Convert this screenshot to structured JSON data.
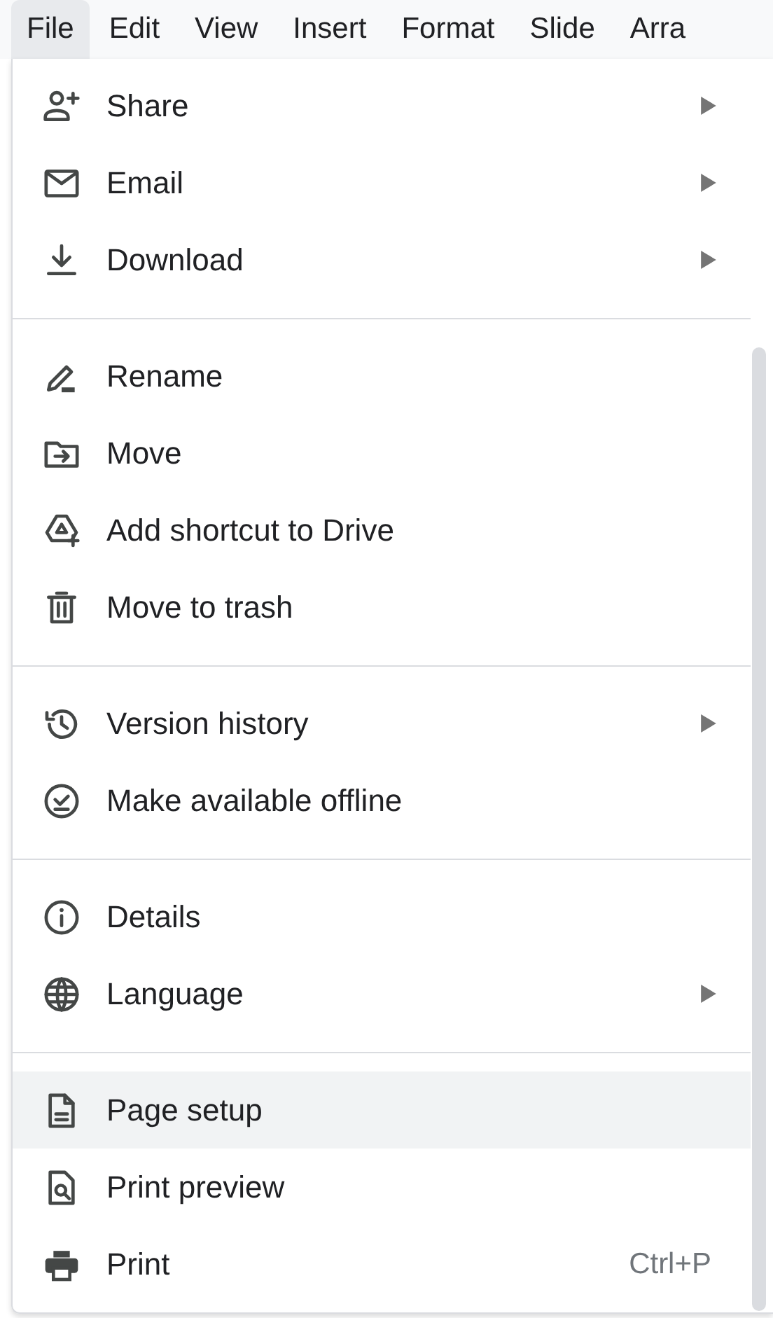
{
  "menubar": [
    {
      "label": "File",
      "selected": true
    },
    {
      "label": "Edit",
      "selected": false
    },
    {
      "label": "View",
      "selected": false
    },
    {
      "label": "Insert",
      "selected": false
    },
    {
      "label": "Format",
      "selected": false
    },
    {
      "label": "Slide",
      "selected": false
    },
    {
      "label": "Arra",
      "selected": false
    }
  ],
  "menu": {
    "groups": [
      {
        "items": [
          {
            "label": "Share",
            "submenu": true,
            "selected": false
          },
          {
            "label": "Email",
            "submenu": true,
            "selected": false
          },
          {
            "label": "Download",
            "submenu": true,
            "selected": false
          }
        ]
      },
      {
        "items": [
          {
            "label": "Rename",
            "submenu": false,
            "selected": false
          },
          {
            "label": "Move",
            "submenu": false,
            "selected": false
          },
          {
            "label": "Add shortcut to Drive",
            "submenu": false,
            "selected": false
          },
          {
            "label": "Move to trash",
            "submenu": false,
            "selected": false
          }
        ]
      },
      {
        "items": [
          {
            "label": "Version history",
            "submenu": true,
            "selected": false
          },
          {
            "label": "Make available offline",
            "submenu": false,
            "selected": false
          }
        ]
      },
      {
        "items": [
          {
            "label": "Details",
            "submenu": false,
            "selected": false
          },
          {
            "label": "Language",
            "submenu": true,
            "selected": false
          }
        ]
      },
      {
        "items": [
          {
            "label": "Page setup",
            "submenu": false,
            "selected": true
          },
          {
            "label": "Print preview",
            "submenu": false,
            "selected": false
          },
          {
            "label": "Print",
            "submenu": false,
            "selected": false,
            "shortcut": "Ctrl+P"
          }
        ]
      }
    ]
  }
}
